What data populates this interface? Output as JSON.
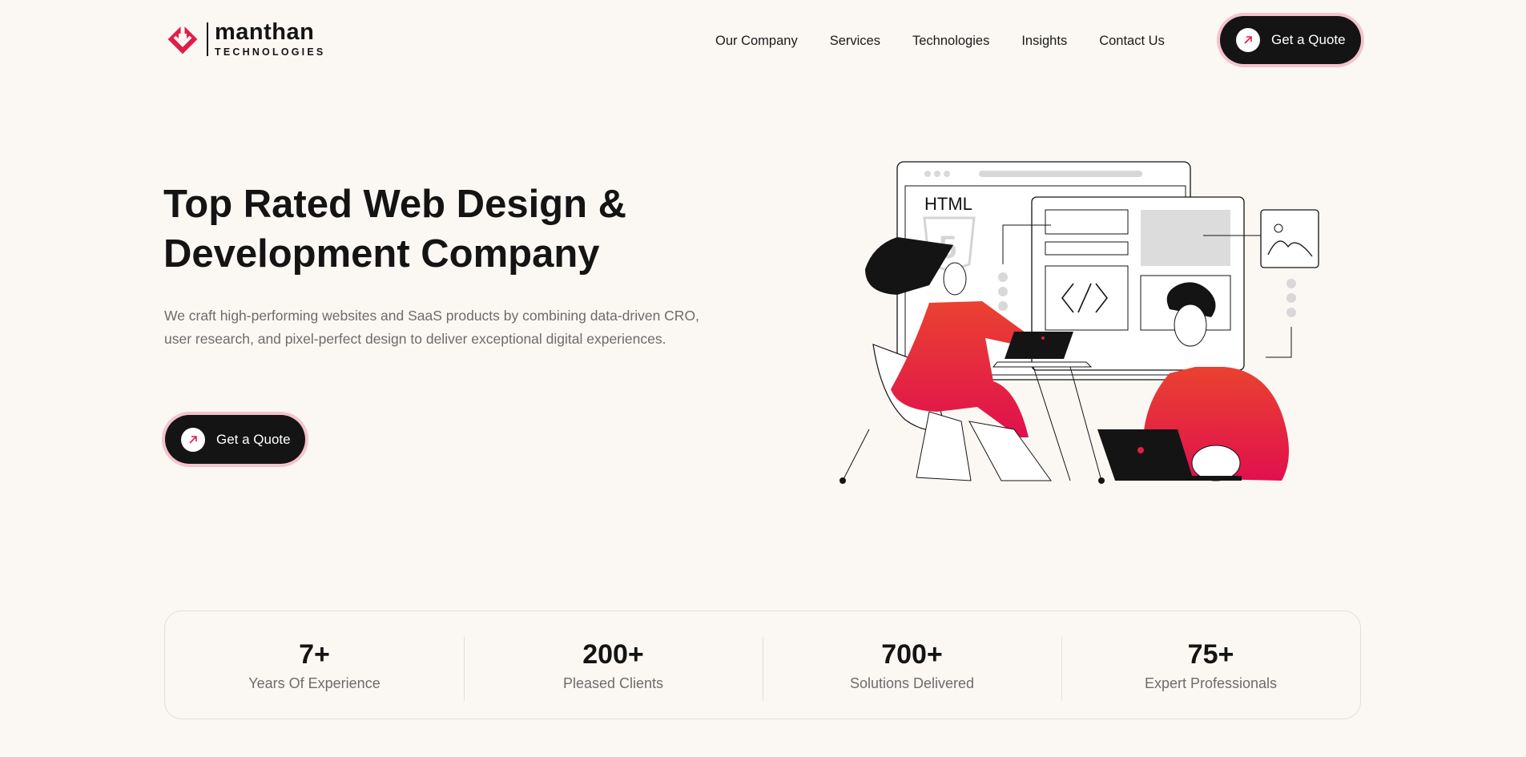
{
  "header": {
    "logo": {
      "name": "manthan",
      "subtitle": "TECHNOLOGIES"
    },
    "nav": [
      "Our Company",
      "Services",
      "Technologies",
      "Insights",
      "Contact Us"
    ],
    "cta_label": "Get a Quote"
  },
  "hero": {
    "title": "Top Rated Web Design & Development Company",
    "description": "We craft high-performing websites and SaaS products by combining data-driven CRO, user research, and pixel-perfect design to deliver exceptional digital experiences.",
    "cta_label": "Get a Quote",
    "illustration": {
      "browser_label": "HTML",
      "shield_digit": "5"
    }
  },
  "stats": [
    {
      "value": "7+",
      "label": "Years Of Experience"
    },
    {
      "value": "200+",
      "label": "Pleased Clients"
    },
    {
      "value": "700+",
      "label": "Solutions Delivered"
    },
    {
      "value": "75+",
      "label": "Expert Professionals"
    }
  ],
  "colors": {
    "accent": "#e21d48",
    "dark": "#141414",
    "background": "#fbf8f4",
    "muted": "#6c6c6c",
    "glow": "#f4c3cd"
  }
}
